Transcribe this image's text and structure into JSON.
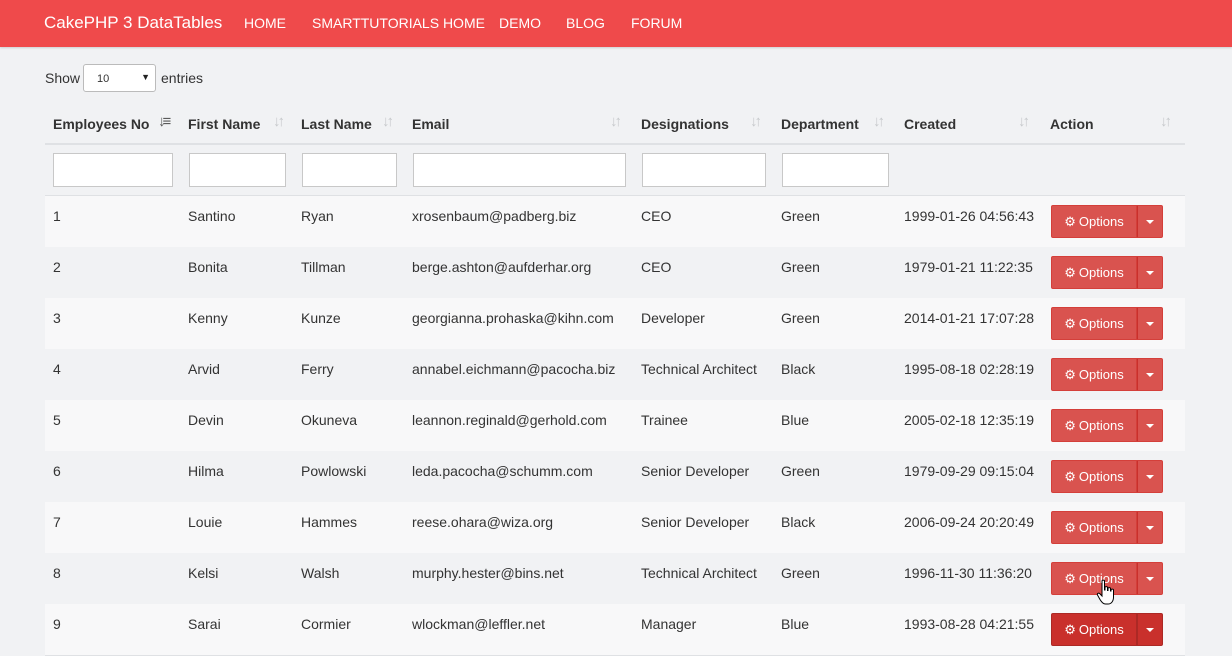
{
  "navbar": {
    "brand": "CakePHP 3 DataTables",
    "items": [
      "HOME",
      "SMARTTUTORIALS HOME",
      "DEMO",
      "BLOG",
      "FORUM"
    ],
    "color": "#ef4a4b"
  },
  "length": {
    "show_label": "Show",
    "value": "10",
    "entries_label": "entries"
  },
  "table": {
    "columns": [
      "Employees No",
      "First Name",
      "Last Name",
      "Email",
      "Designations",
      "Department",
      "Created",
      "Action"
    ],
    "sorted_column": "Employees No",
    "rows": [
      [
        "1",
        "Santino",
        "Ryan",
        "xrosenbaum@padberg.biz",
        "CEO",
        "Green",
        "1999-01-26 04:56:43"
      ],
      [
        "2",
        "Bonita",
        "Tillman",
        "berge.ashton@aufderhar.org",
        "CEO",
        "Green",
        "1979-01-21 11:22:35"
      ],
      [
        "3",
        "Kenny",
        "Kunze",
        "georgianna.prohaska@kihn.com",
        "Developer",
        "Green",
        "2014-01-21 17:07:28"
      ],
      [
        "4",
        "Arvid",
        "Ferry",
        "annabel.eichmann@pacocha.biz",
        "Technical Architect",
        "Black",
        "1995-08-18 02:28:19"
      ],
      [
        "5",
        "Devin",
        "Okuneva",
        "leannon.reginald@gerhold.com",
        "Trainee",
        "Blue",
        "2005-02-18 12:35:19"
      ],
      [
        "6",
        "Hilma",
        "Powlowski",
        "leda.pacocha@schumm.com",
        "Senior Developer",
        "Green",
        "1979-09-29 09:15:04"
      ],
      [
        "7",
        "Louie",
        "Hammes",
        "reese.ohara@wiza.org",
        "Senior Developer",
        "Black",
        "2006-09-24 20:20:49"
      ],
      [
        "8",
        "Kelsi",
        "Walsh",
        "murphy.hester@bins.net",
        "Technical Architect",
        "Green",
        "1996-11-30 11:36:20"
      ],
      [
        "9",
        "Sarai",
        "Cormier",
        "wlockman@leffler.net",
        "Manager",
        "Blue",
        "1993-08-28 04:21:55"
      ]
    ],
    "action_label": "Options",
    "button_color": "#d9534f"
  }
}
